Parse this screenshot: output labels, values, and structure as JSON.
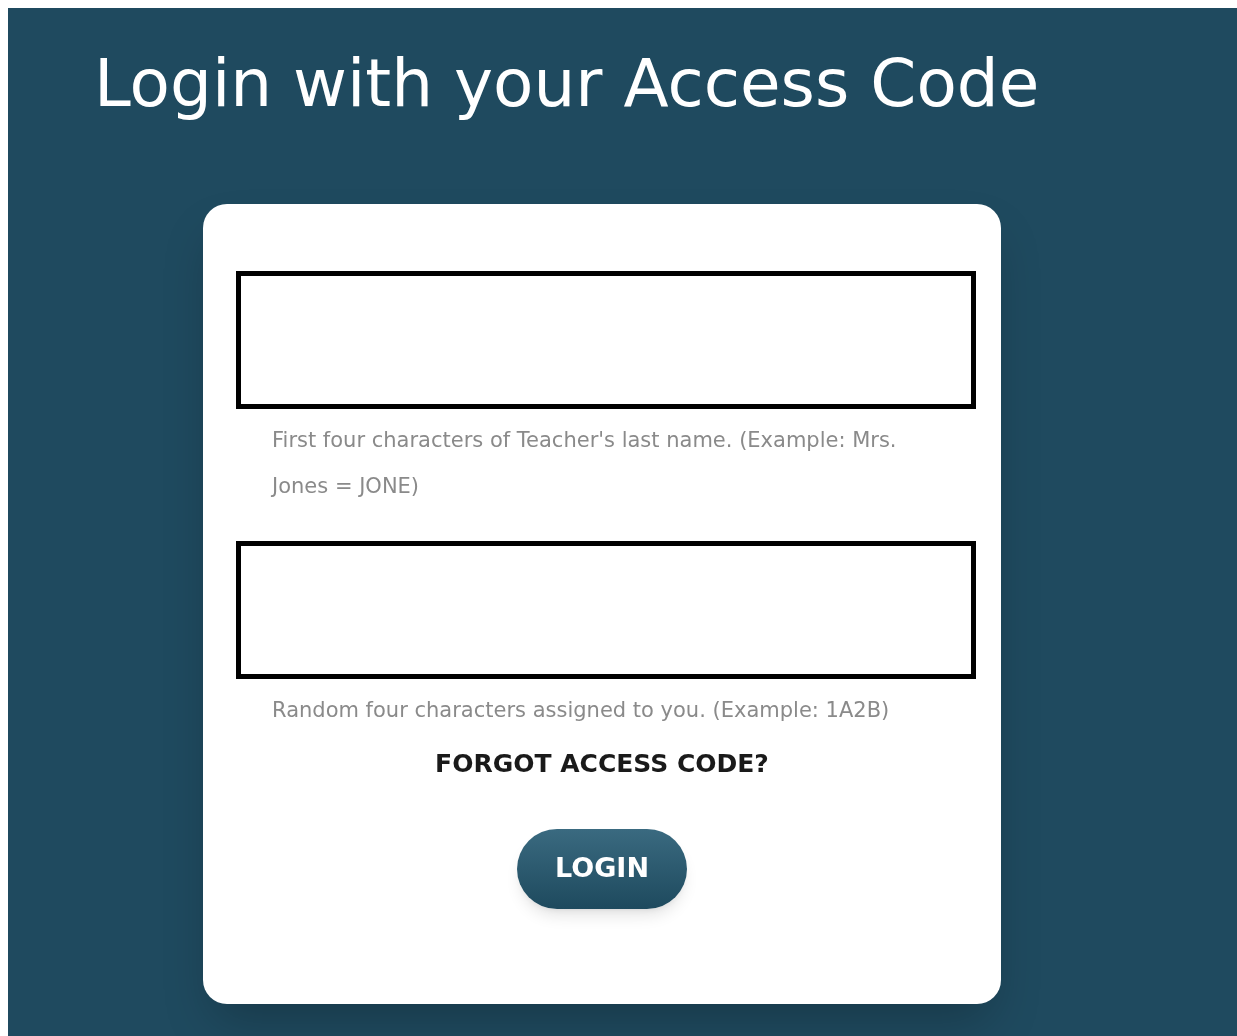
{
  "title": "Login with your Access Code",
  "fields": [
    {
      "help": "First four characters of Teacher's last name. (Example: Mrs. Jones = JONE)"
    },
    {
      "help": "Random four characters assigned to you. (Example: 1A2B)"
    }
  ],
  "forgot_link": "FORGOT ACCESS CODE?",
  "login_button": "LOGIN"
}
